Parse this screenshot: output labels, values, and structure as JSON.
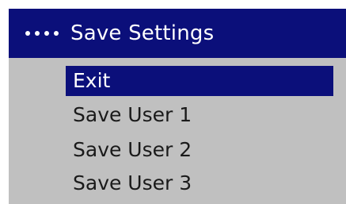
{
  "window": {
    "title": "Save Settings",
    "header_icon": "four-dots-icon"
  },
  "menu": {
    "selected_index": 0,
    "items": [
      {
        "label": "Exit"
      },
      {
        "label": "Save User 1"
      },
      {
        "label": "Save User 2"
      },
      {
        "label": "Save User 3"
      }
    ]
  },
  "colors": {
    "header_bg": "#0b0f7a",
    "panel_bg": "#c0c0c0",
    "selection_bg": "#0b0f7a",
    "text": "#1a1a1a",
    "selected_text": "#ffffff"
  }
}
